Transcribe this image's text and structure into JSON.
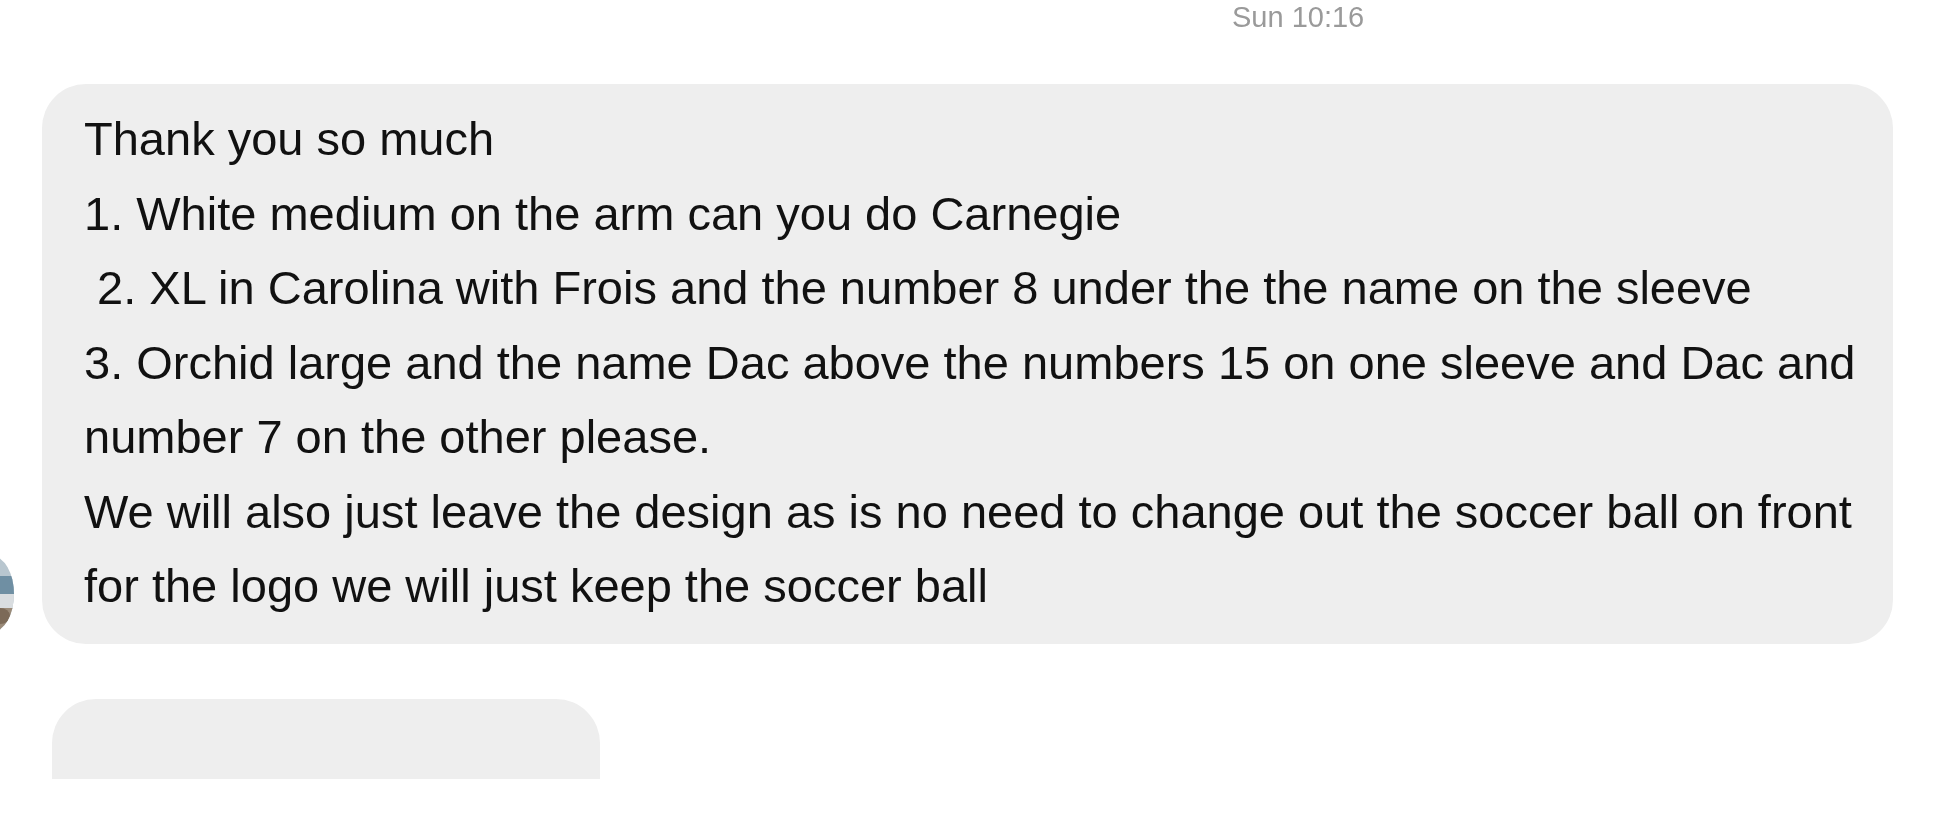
{
  "timestamp": "Sun 10:16",
  "messages": [
    {
      "kind": "text",
      "paragraphs": [
        "Thank you so much",
        "1. White medium on the arm can you do Carnegie",
        " 2. XL in Carolina with Frois and the number 8 under the the name on the sleeve",
        "3. Orchid large and the name Dac above the numbers 15 on one sleeve and Dac and number 7 on the other please.",
        "We will also just leave the design as is no need to change out the soccer ball on front for the logo we will just keep the soccer ball"
      ]
    },
    {
      "kind": "empty"
    }
  ]
}
